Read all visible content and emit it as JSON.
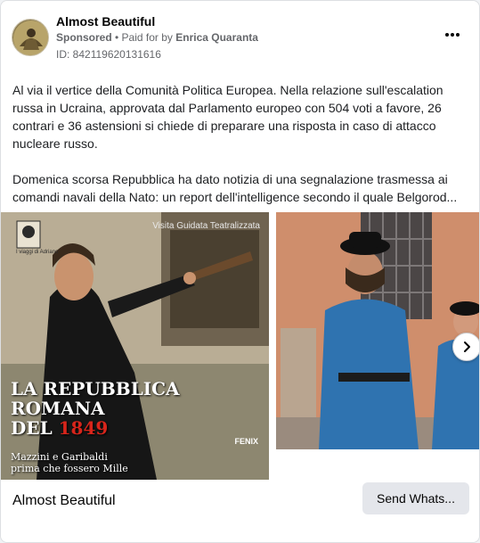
{
  "post": {
    "page_name": "Almost Beautiful",
    "sponsored_label": "Sponsored",
    "separator": " • ",
    "paid_for_prefix": "Paid for by ",
    "payer": "Enrica Quaranta",
    "ad_id": "ID: 842119620131616",
    "more_icon": "more-options-icon"
  },
  "body": {
    "paragraph1": "Al via il vertice della Comunità Politica Europea. Nella relazione sull'escalation russa in Ucraina, approvata dal Parlamento europeo con 504 voti a favore, 26 contrari e 36 astensioni si chiede di preparare una risposta in caso di attacco nucleare russo.",
    "paragraph2_line1": "Domenica scorsa Repubblica ha dato notizia di una segnalazione trasmessa ai",
    "paragraph2_line2": "comandi navali della Nato: un report dell'intelligence secondo il quale Belgorod..."
  },
  "carousel": {
    "slide1": {
      "tag": "Visita Guidata Teatralizzata",
      "logo_text": "I viaggi di Adriano",
      "title_line1": "LA REPUBBLICA",
      "title_line2": "ROMANA",
      "title_line3_prefix": "DEL ",
      "title_year": "1849",
      "subtitle_line1": "Mazzini e Garibaldi",
      "subtitle_line2": "prima che fossero Mille",
      "brand": "FENIX"
    },
    "next_icon": "chevron-right-icon"
  },
  "footer": {
    "title": "Almost Beautiful",
    "cta_label": "Send Whats..."
  },
  "colors": {
    "accent_red": "#d8251b",
    "button_bg": "#e4e6eb",
    "muted_text": "#65676b"
  }
}
